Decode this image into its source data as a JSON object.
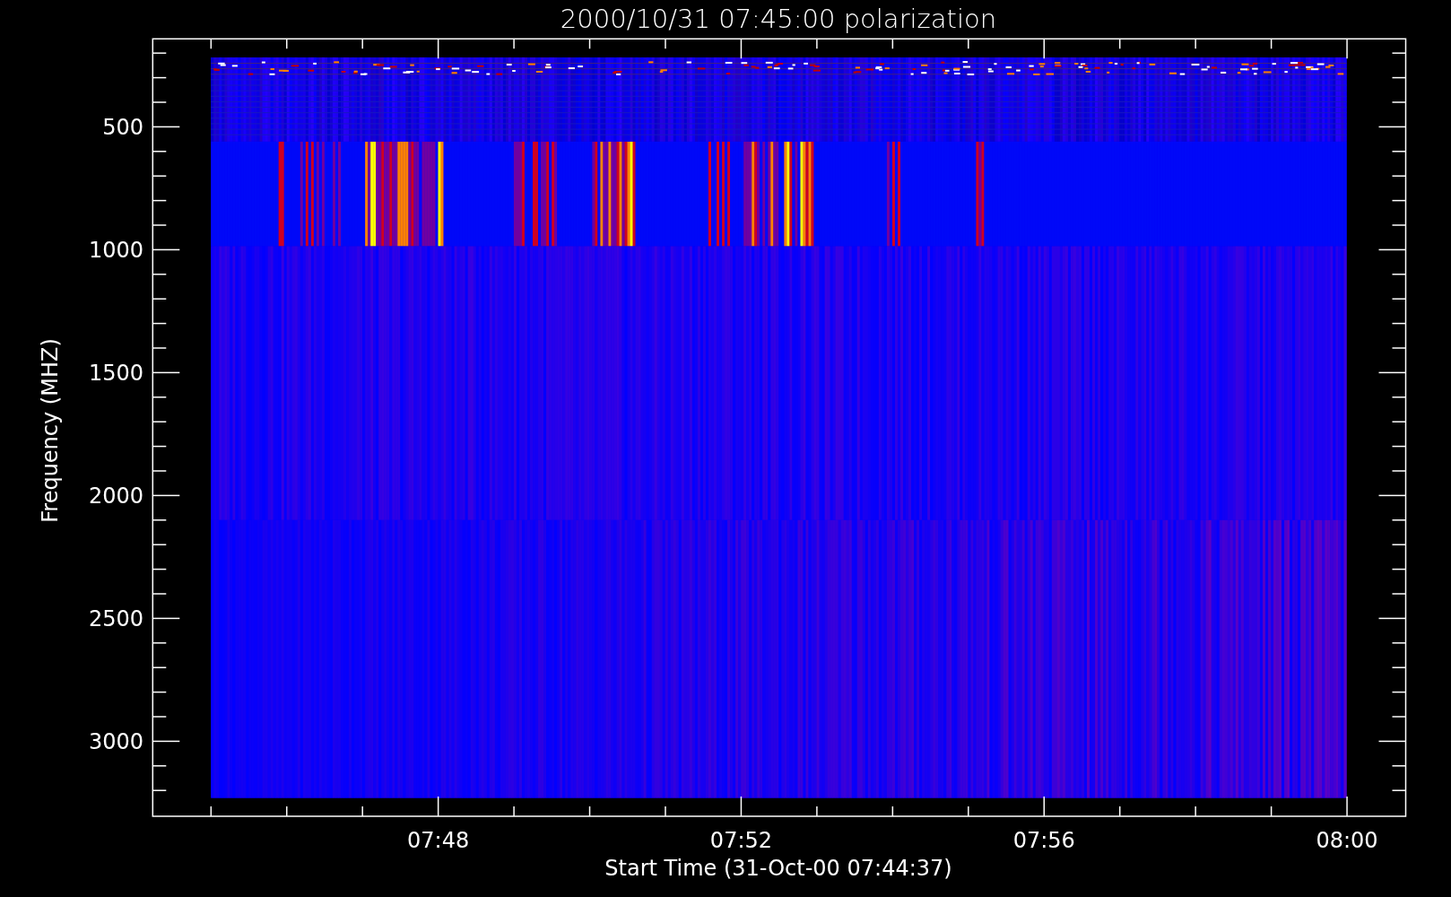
{
  "title": "2000/10/31 07:45:00 polarization",
  "y_axis": {
    "label": "Frequency (MHZ)",
    "tick_labels": [
      "500",
      "1000",
      "1500",
      "2000",
      "2500",
      "3000"
    ]
  },
  "x_axis": {
    "label": "Start Time (31-Oct-00 07:44:37)",
    "tick_labels": [
      "07:48",
      "07:52",
      "07:56",
      "08:00"
    ]
  }
}
